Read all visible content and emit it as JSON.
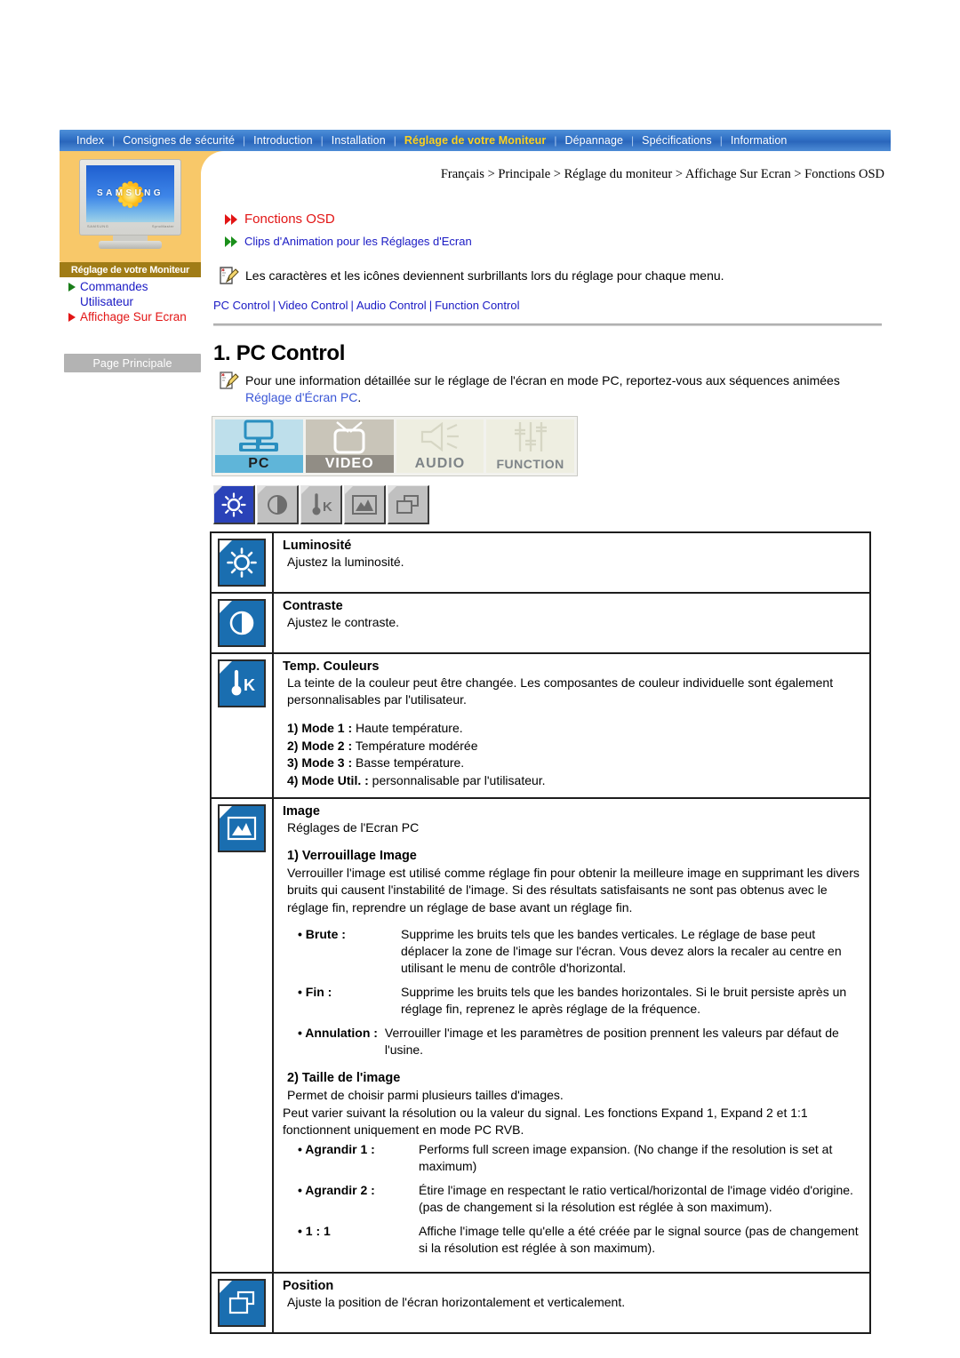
{
  "nav": {
    "items": [
      {
        "label": "Index",
        "active": false
      },
      {
        "label": "Consignes de sécurité",
        "active": false
      },
      {
        "label": "Introduction",
        "active": false
      },
      {
        "label": "Installation",
        "active": false
      },
      {
        "label": "Réglage de votre Moniteur",
        "active": true
      },
      {
        "label": "Dépannage",
        "active": false
      },
      {
        "label": "Spécifications",
        "active": false
      },
      {
        "label": "Information",
        "active": false
      }
    ],
    "separator": "|"
  },
  "sidebar": {
    "monitor_word": "SAMSUNG",
    "monitor_brand": "SAMSUNG",
    "monitor_model": "SyncMaster",
    "caption": "Réglage de votre Moniteur",
    "links": [
      {
        "label": "Commandes Utilisateur",
        "color": "#1a1ac4"
      },
      {
        "label": "Affichage Sur Ecran",
        "color": "#e21515"
      }
    ],
    "home_button": "Page Principale"
  },
  "main": {
    "breadcrumb": "Français > Principale > Réglage du moniteur > Affichage Sur Ecran > Fonctions OSD",
    "heading_osd": "Fonctions OSD",
    "heading_clips": "Clips d'Animation pour les Réglages d'Ecran",
    "note_top": "Les caractères et les icônes deviennent surbrillants lors du réglage pour chaque menu.",
    "control_links": [
      "PC Control",
      "Video Control",
      "Audio Control",
      "Function Control"
    ],
    "control_sep": "|",
    "section_title": "1. PC Control",
    "note_pc_part1": "Pour une information détaillée sur le réglage de l'écran en mode PC, reportez-vous aux séquences animées ",
    "note_pc_link": "Réglage d'Écran PC",
    "note_pc_part2": "."
  },
  "tabs": [
    {
      "label": "PC",
      "icon": "computer-monitor-icon",
      "state": "selected"
    },
    {
      "label": "VIDEO",
      "icon": "television-icon",
      "state": "normal"
    },
    {
      "label": "AUDIO",
      "icon": "speaker-icon",
      "state": "dimmed"
    },
    {
      "label": "FUNCTION",
      "icon": "sliders-icon",
      "state": "dimmed"
    }
  ],
  "mini_icons": [
    {
      "name": "brightness-sun-icon",
      "state": "selected"
    },
    {
      "name": "contrast-circle-icon",
      "state": "normal"
    },
    {
      "name": "color-temperature-icon",
      "state": "normal"
    },
    {
      "name": "picture-image-icon",
      "state": "normal"
    },
    {
      "name": "position-frames-icon",
      "state": "normal"
    }
  ],
  "table": {
    "rows": [
      {
        "icon": "brightness-sun-icon",
        "title": "Luminosité",
        "desc": "Ajustez la luminosité."
      },
      {
        "icon": "contrast-circle-icon",
        "title": "Contraste",
        "desc": "Ajustez le contraste."
      },
      {
        "icon": "color-temperature-icon",
        "title": "Temp. Couleurs",
        "desc": "La teinte de la couleur peut être changée. Les composantes de couleur individuelle sont également personnalisables par l'utilisateur.",
        "modes": [
          {
            "num": "1) Mode 1 :",
            "text": " Haute température."
          },
          {
            "num": "2) Mode 2 :",
            "text": " Température modérée"
          },
          {
            "num": "3) Mode 3 :",
            "text": " Basse température."
          },
          {
            "num": "4) Mode Util. :",
            "text": " personnalisable par l'utilisateur."
          }
        ]
      },
      {
        "icon": "picture-image-icon",
        "title": "Image",
        "desc": "Réglages de l'Ecran PC",
        "sub1_title": "1) Verrouillage Image",
        "sub1_text": "Verrouiller l'image est utilisé comme réglage fin pour obtenir la meilleure image en supprimant les divers bruits qui causent l'instabilité de l'image. Si des résultats satisfaisants ne sont pas obtenus avec le réglage fin, reprendre un réglage de base avant un réglage fin.",
        "sub1_bullets": [
          {
            "label": "• Brute :",
            "text": "Supprime les bruits tels que les bandes verticales. Le réglage de base peut déplacer la zone de l'image sur l'écran. Vous devez alors la recaler au centre en utilisant le menu de contrôle d'horizontal."
          },
          {
            "label": "• Fin :",
            "text": "Supprime les bruits tels que les bandes horizontales. Si le bruit persiste après un réglage fin, reprenez le après réglage de la fréquence."
          },
          {
            "label": "• Annulation :",
            "text": "Verrouiller l'image et les paramètres de position prennent les valeurs par défaut de l'usine."
          }
        ],
        "sub2_title": "2) Taille de l'image",
        "sub2_text1": "Permet de choisir parmi plusieurs tailles d'images.",
        "sub2_text2": "Peut varier suivant la résolution ou la valeur du signal. Les fonctions Expand 1, Expand 2 et 1:1 fonctionnent uniquement en mode PC RVB.",
        "sub2_bullets": [
          {
            "label": "• Agrandir 1 :",
            "text": "Performs full screen image expansion. (No change if the resolution is set at maximum)"
          },
          {
            "label": "• Agrandir 2 :",
            "text": "Étire l'image en respectant le ratio vertical/horizontal de l'image vidéo d'origine. (pas de changement si la résolution est réglée à son maximum)."
          },
          {
            "label": "• 1 : 1",
            "text": "Affiche l'image telle qu'elle a été créée par le signal source (pas de changement si la résolution est réglée à son maximum)."
          }
        ]
      },
      {
        "icon": "position-frames-icon",
        "title": "Position",
        "desc": "Ajuste la position de l'écran horizontalement et verticalement."
      }
    ]
  },
  "colors": {
    "nav_blue": "#2f6fc4",
    "nav_active": "#ffd21c",
    "sidebar_yellow": "#f8c869",
    "caption_brown": "#a07c16",
    "link_blue": "#1a1ac4",
    "accent_red": "#e21515",
    "icon_blue": "#1a6eb0"
  }
}
